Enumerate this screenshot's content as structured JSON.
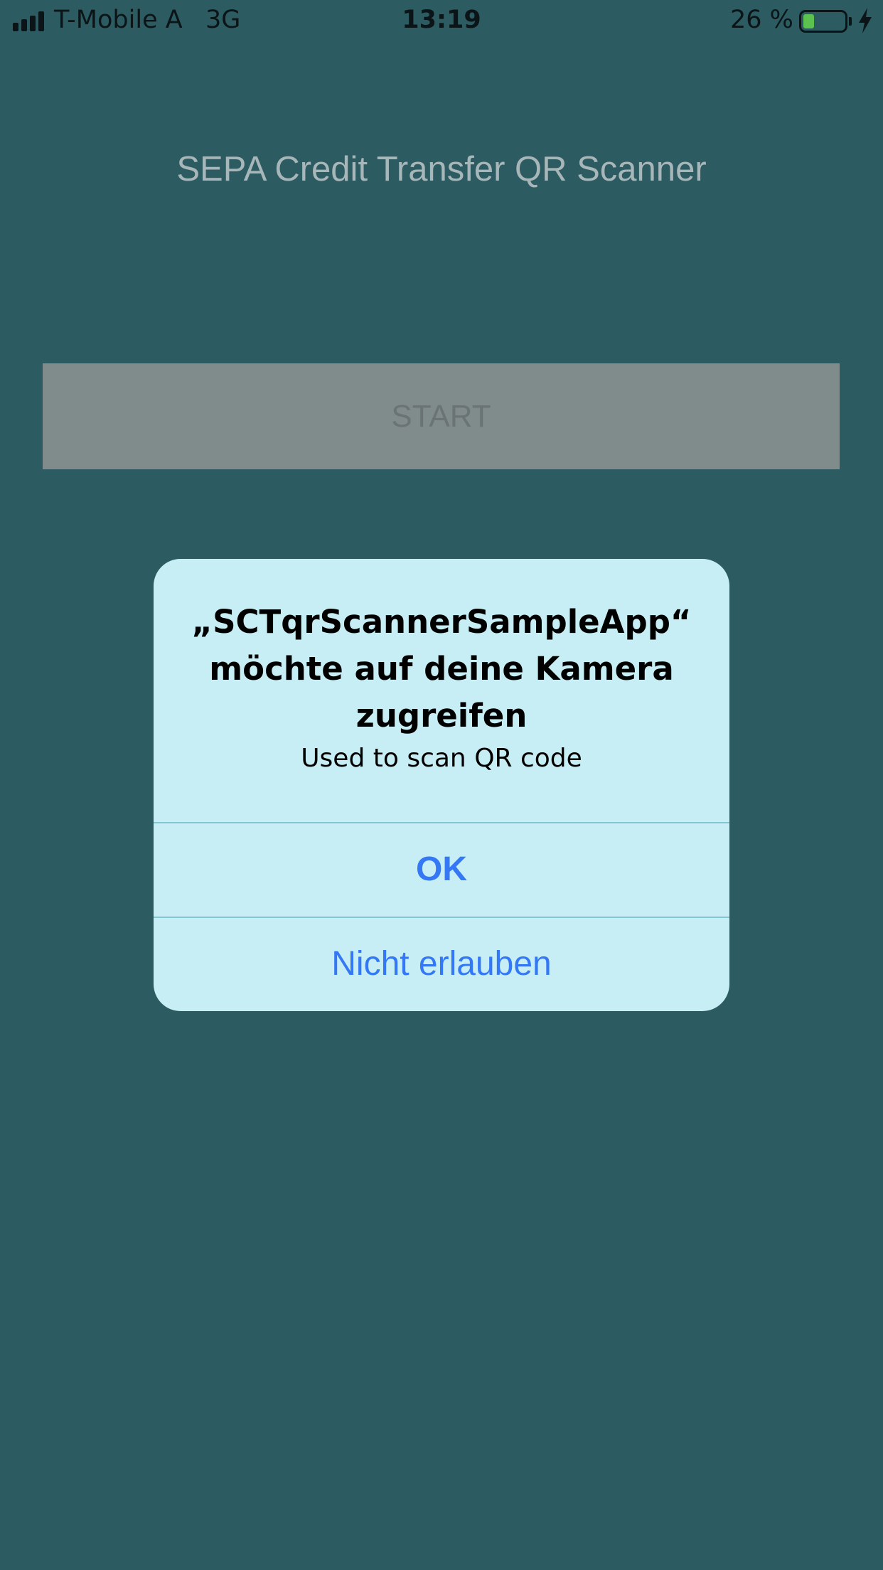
{
  "status_bar": {
    "carrier": "T-Mobile A",
    "network": "3G",
    "time": "13:19",
    "battery_percent_text": "26 %",
    "battery_level": 0.26,
    "battery_color": "#5bc24f",
    "signal_icon": "signal-bars-icon",
    "battery_icon": "battery-icon",
    "charging_icon": "lightning-bolt-icon"
  },
  "app": {
    "title": "SEPA Credit Transfer QR Scanner",
    "start_label": "START"
  },
  "alert": {
    "title": "„SCTqrScannerSampleApp“ möchte auf deine Kamera zugreifen",
    "message": "Used to scan QR code",
    "ok_label": "OK",
    "deny_label": "Nicht erlauben",
    "button_color": "#3478f6"
  }
}
